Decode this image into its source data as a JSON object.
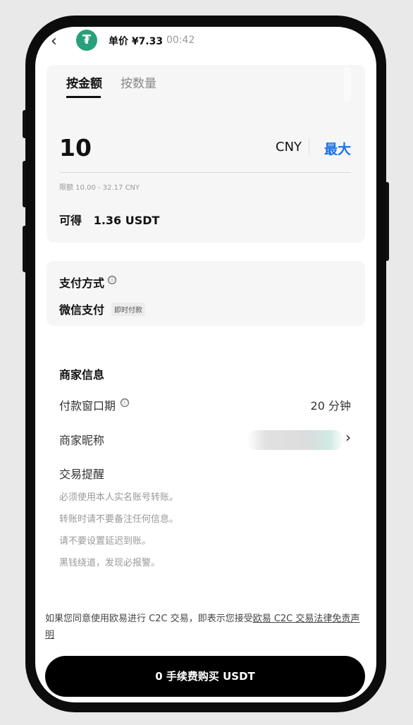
{
  "header": {
    "back_icon": "chevron-left-icon",
    "coin_icon": "tether-icon",
    "coin_symbol": "₮",
    "price": "单价 ¥7.33",
    "timer": "00:42"
  },
  "tabs": [
    {
      "label": "按金额",
      "active": true
    },
    {
      "label": "按数量",
      "active": false
    }
  ],
  "amount": {
    "value": "10",
    "currency": "CNY",
    "max_label": "最大",
    "limit": "限额 10.00 - 32.17 CNY",
    "receive": "可得   1.36 USDT"
  },
  "payment": {
    "title": "支付方式",
    "info_icon": "ⓘ",
    "method": "微信支付",
    "badge": "即时付款"
  },
  "merchant": {
    "title": "商家信息",
    "period_label": "付款窗口期",
    "period_value": "20 分钟",
    "nickname_label": "商家昵称",
    "tips_title": "交易提醒",
    "tips": [
      "必须使用本人实名账号转账。",
      "转账时请不要备注任何信息。",
      "请不要设置延迟到账。",
      "黑钱绕道，发现必报警。"
    ]
  },
  "disclaimer": {
    "text": "如果您同意使用欧易进行 C2C 交易，即表示您接受",
    "link": "欧易 C2C 交易法律免责声明"
  },
  "buy_button": "0 手续费购买 USDT",
  "colors": {
    "accent": "#1a73e8",
    "button": "#000000",
    "card": "#f6f6f6",
    "coin": "#26a17b"
  }
}
